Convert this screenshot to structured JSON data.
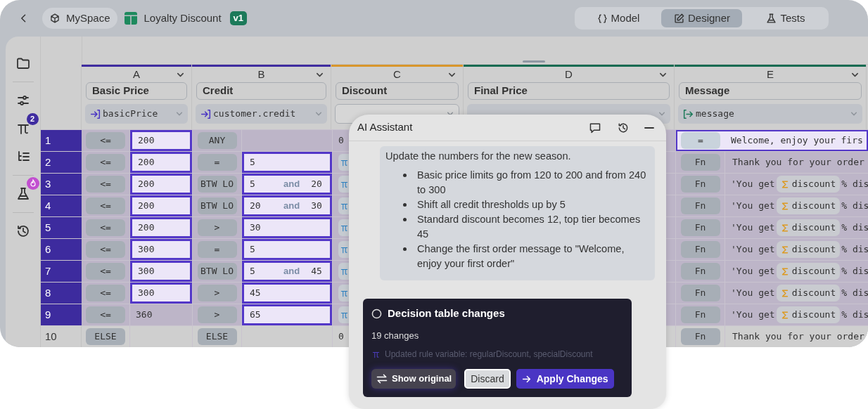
{
  "topbar": {
    "workspace": "MySpace",
    "document": "Loyalty Discount",
    "version": "v1",
    "tabs": [
      {
        "label": "Model",
        "kind": "model",
        "selected": false
      },
      {
        "label": "Designer",
        "kind": "designer",
        "selected": true
      },
      {
        "label": "Tests",
        "kind": "tests",
        "selected": false
      }
    ]
  },
  "sidebar": {
    "items": [
      {
        "kind": "folder"
      },
      {
        "kind": "sliders"
      },
      {
        "kind": "pi",
        "badge": "2"
      },
      {
        "kind": "list"
      },
      {
        "kind": "flask",
        "alert": true
      },
      {
        "kind": "history"
      }
    ]
  },
  "columns": [
    {
      "letter": "A",
      "label": "Basic Price",
      "variable": "basicPrice",
      "kind": "input",
      "color": "#3f2ca0"
    },
    {
      "letter": "B",
      "label": "Credit",
      "variable": "customer.credit",
      "kind": "input",
      "color": "#3f2ca0"
    },
    {
      "letter": "C",
      "label": "Discount",
      "kind": "rule",
      "color": "#d8962c"
    },
    {
      "letter": "D",
      "label": "Final Price",
      "kind": "output",
      "color": "#176b52"
    },
    {
      "letter": "E",
      "label": "Message",
      "variable": "message",
      "kind": "output",
      "color": "#176b52"
    }
  ],
  "rows": [
    {
      "number": "1",
      "active": true,
      "cells": [
        {
          "kind": "condition",
          "op": "<=",
          "value": "200",
          "changed": true
        },
        {
          "kind": "condition",
          "op": "ANY",
          "changed": false
        },
        {
          "kind": "number",
          "value": "0"
        },
        {
          "kind": "output",
          "op": "=",
          "value": "Welcome, enjoy your firs",
          "changed": true
        }
      ]
    },
    {
      "number": "2",
      "active": true,
      "cells": [
        {
          "kind": "condition",
          "op": "<=",
          "value": "200",
          "changed": true
        },
        {
          "kind": "condition",
          "op": "=",
          "value": "5",
          "changed": true
        },
        {
          "kind": "ref"
        },
        {
          "kind": "output",
          "op": "Fn",
          "value": "Thank you for your order",
          "changed": false
        }
      ]
    },
    {
      "number": "3",
      "active": true,
      "cells": [
        {
          "kind": "condition",
          "op": "<=",
          "value": "200",
          "changed": true
        },
        {
          "kind": "range",
          "op": "BTW LO",
          "from": "5",
          "joiner": "and",
          "to": "20",
          "changed": true
        },
        {
          "kind": "ref"
        },
        {
          "kind": "template",
          "op": "Fn",
          "prefix": "'You get",
          "ref": "discount",
          "suffix": "% dis",
          "changed": false
        }
      ]
    },
    {
      "number": "4",
      "active": true,
      "cells": [
        {
          "kind": "condition",
          "op": "<=",
          "value": "200",
          "changed": true
        },
        {
          "kind": "range",
          "op": "BTW LO",
          "from": "20",
          "joiner": "and",
          "to": "30",
          "changed": true
        },
        {
          "kind": "ref"
        },
        {
          "kind": "template",
          "op": "Fn",
          "prefix": "'You get",
          "ref": "discount",
          "suffix": "% dis",
          "changed": false
        }
      ]
    },
    {
      "number": "5",
      "active": true,
      "cells": [
        {
          "kind": "condition",
          "op": "<=",
          "value": "200",
          "changed": true
        },
        {
          "kind": "condition",
          "op": ">",
          "value": "30",
          "changed": true
        },
        {
          "kind": "ref"
        },
        {
          "kind": "template",
          "op": "Fn",
          "prefix": "'You get",
          "ref": "discount",
          "suffix": "% dis",
          "changed": false
        }
      ]
    },
    {
      "number": "6",
      "active": true,
      "cells": [
        {
          "kind": "condition",
          "op": "<=",
          "value": "300",
          "changed": true
        },
        {
          "kind": "condition",
          "op": "=",
          "value": "5",
          "changed": true
        },
        {
          "kind": "ref"
        },
        {
          "kind": "template",
          "op": "Fn",
          "prefix": "'You get",
          "ref": "discount",
          "suffix": "% dis",
          "changed": false
        }
      ]
    },
    {
      "number": "7",
      "active": true,
      "cells": [
        {
          "kind": "condition",
          "op": "<=",
          "value": "300",
          "changed": true
        },
        {
          "kind": "range",
          "op": "BTW LO",
          "from": "5",
          "joiner": "and",
          "to": "45",
          "changed": true
        },
        {
          "kind": "ref"
        },
        {
          "kind": "template",
          "op": "Fn",
          "prefix": "'You get",
          "ref": "discount",
          "suffix": "% dis",
          "changed": false
        }
      ]
    },
    {
      "number": "8",
      "active": true,
      "cells": [
        {
          "kind": "condition",
          "op": "<=",
          "value": "300",
          "changed": true
        },
        {
          "kind": "condition",
          "op": ">",
          "value": "45",
          "changed": true
        },
        {
          "kind": "ref"
        },
        {
          "kind": "template",
          "op": "Fn",
          "prefix": "'You get",
          "ref": "discount",
          "suffix": "% dis",
          "changed": false
        }
      ]
    },
    {
      "number": "9",
      "active": true,
      "cells": [
        {
          "kind": "condition",
          "op": "<=",
          "value": "360",
          "changed": false
        },
        {
          "kind": "condition",
          "op": ">",
          "value": "65",
          "changed": true
        },
        {
          "kind": "ref"
        },
        {
          "kind": "template",
          "op": "Fn",
          "prefix": "'You get",
          "ref": "discount",
          "suffix": "% dis",
          "changed": false
        }
      ]
    },
    {
      "number": "10",
      "active": false,
      "cells": [
        {
          "kind": "condition",
          "op": "ELSE",
          "changed": false
        },
        {
          "kind": "condition",
          "op": "ELSE",
          "changed": false
        },
        {
          "kind": "number",
          "value": "0"
        },
        {
          "kind": "output",
          "op": "Fn",
          "value": "Thank you for your order",
          "changed": false
        }
      ]
    }
  ],
  "assistant": {
    "title": "AI Assistant",
    "message": {
      "intro": "Update the numbers for the new season.",
      "bullets": [
        "Basic price limits go from 120 to 200 and from 240 to 300",
        "Shift all credit thresholds up by 5",
        "Standard discount becomes 12, top tier becomes 45",
        "Change the first order message to \"Welcome, enjoy your first order\""
      ]
    },
    "changes": {
      "title": "Decision table changes",
      "count": "19 changes",
      "detail": "Updated rule variable: regularDiscount, specialDiscount",
      "actions": [
        {
          "label": "Show original",
          "kind": "toggle"
        },
        {
          "label": "Discard",
          "kind": "secondary"
        },
        {
          "label": "Apply Changes",
          "kind": "primary"
        }
      ]
    }
  }
}
